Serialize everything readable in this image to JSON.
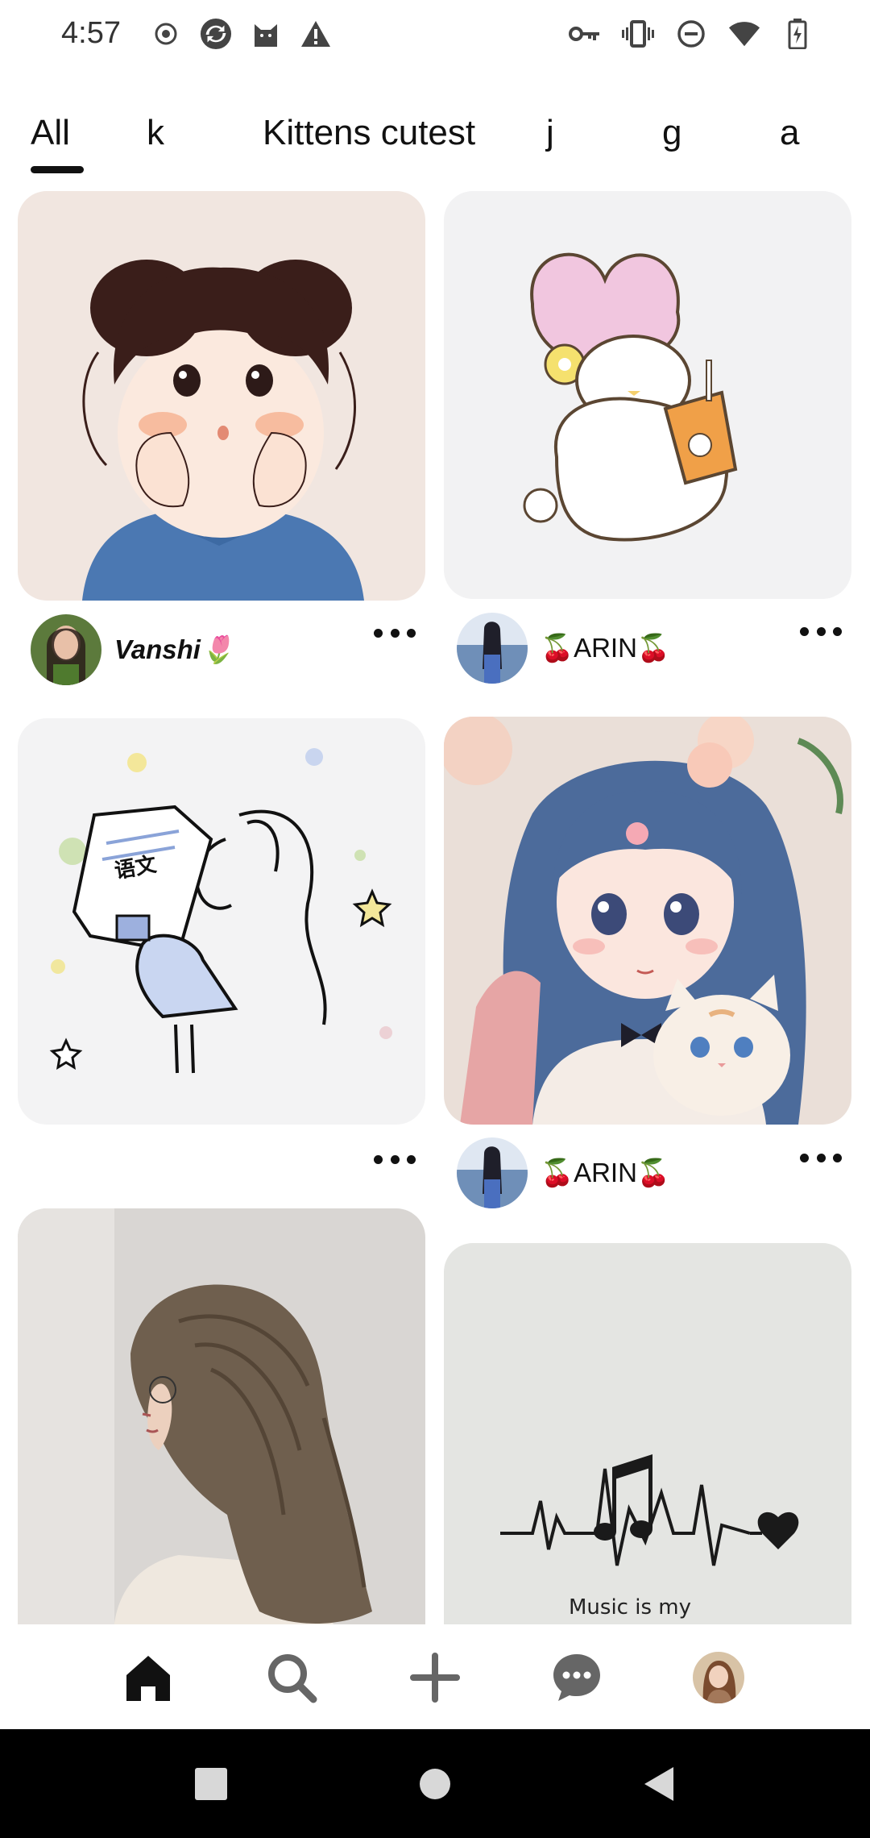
{
  "status_bar": {
    "time": "4:57",
    "left_icons": [
      "record-icon",
      "sync-icon",
      "cat-icon",
      "warning-icon"
    ],
    "right_icons": [
      "vpn-key-icon",
      "vibrate-icon",
      "do-not-disturb-icon",
      "wifi-icon",
      "battery-charging-icon"
    ]
  },
  "tabs": [
    {
      "label": "All",
      "selected": true
    },
    {
      "label": "k",
      "selected": false
    },
    {
      "label": "Kittens cutest",
      "selected": false
    },
    {
      "label": "j",
      "selected": false
    },
    {
      "label": "g",
      "selected": false
    },
    {
      "label": "a",
      "selected": false
    }
  ],
  "pins": [
    {
      "id": "pin-girl-buns",
      "author": "Vanshi🌷",
      "has_meta": true
    },
    {
      "id": "pin-bunny-boba",
      "author": "🍒ARIN🍒",
      "has_meta": true
    },
    {
      "id": "pin-study-girl",
      "author": "",
      "has_meta": false
    },
    {
      "id": "pin-anime-girl-cat",
      "author": "🍒ARIN🍒",
      "has_meta": true
    },
    {
      "id": "pin-hair-photo",
      "author": "",
      "has_meta": false
    },
    {
      "id": "pin-music-heartbeat",
      "author": "",
      "has_meta": false
    }
  ],
  "music_sketch_text": "Music is my",
  "study_book_text": "语文",
  "bottom_nav": [
    "home-icon",
    "search-icon",
    "create-icon",
    "messages-icon",
    "profile-avatar"
  ],
  "colors": {
    "accent": "#111111",
    "background": "#ffffff"
  }
}
